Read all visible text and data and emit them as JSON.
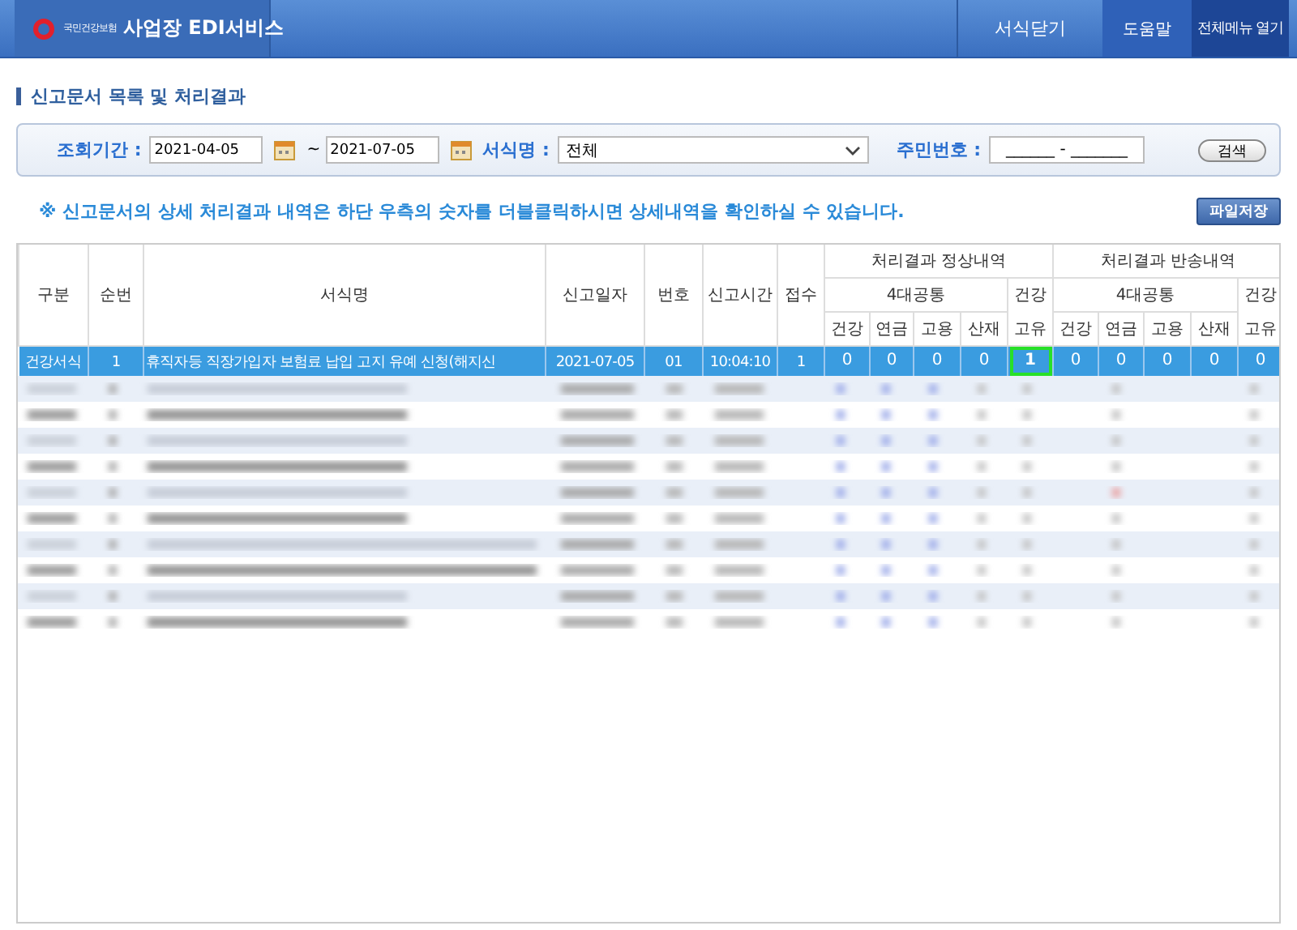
{
  "header": {
    "logo_text": "국민건강보험",
    "service_title": "사업장 EDI서비스",
    "buttons": [
      {
        "label": "서식닫기",
        "kind": "plain"
      },
      {
        "label": "도움말",
        "kind": "dark"
      },
      {
        "label": "전체메뉴 열기",
        "kind": "darker"
      }
    ]
  },
  "page_title": "신고문서 목록 및 처리결과",
  "search": {
    "period_label": "조회기간 :",
    "date_from": "2021-04-05",
    "date_sep": "~",
    "date_to": "2021-07-05",
    "form_label": "서식명 :",
    "form_value": "전체",
    "id_label": "주민번호 :",
    "id_value": "______ - _______",
    "search_button": "검색"
  },
  "notice": "※ 신고문서의 상세 처리결과 내역은 하단 **우측의 숫자**를 **더블클릭**하시면 상세내역을 확인하실 수 있습니다.",
  "save_button": "파일저장",
  "table": {
    "fixed_columns": [
      "구분",
      "순번",
      "서식명",
      "신고일자",
      "번호",
      "신고시간",
      "접수"
    ],
    "groups": [
      {
        "label": "처리결과 정상내역",
        "common_label": "4대공통",
        "common_columns": [
          "건강",
          "연금",
          "고용",
          "산재"
        ],
        "extra_top": "건강",
        "extra_bottom": "고유"
      },
      {
        "label": "처리결과 반송내역",
        "common_label": "4대공통",
        "common_columns": [
          "건강",
          "연금",
          "고용",
          "산재"
        ],
        "extra_top": "건강",
        "extra_bottom": "고유"
      }
    ],
    "rows": [
      {
        "selected": true,
        "cells": [
          "건강서식",
          "1",
          "휴직자등 직장가입자 보험료 납입 고지 유예 신청(해지신",
          "2021-07-05",
          "01",
          "10:04:10",
          "1"
        ],
        "results": [
          {
            "text": "0",
            "focused": false
          },
          {
            "text": "0",
            "focused": false
          },
          {
            "text": "0",
            "focused": false
          },
          {
            "text": "0",
            "focused": false
          },
          {
            "text": "1",
            "focused": true
          },
          {
            "text": "0",
            "focused": false
          },
          {
            "text": "0",
            "focused": false
          },
          {
            "text": "0",
            "focused": false
          },
          {
            "text": "0",
            "focused": false
          },
          {
            "text": "0",
            "focused": false
          }
        ]
      }
    ]
  }
}
